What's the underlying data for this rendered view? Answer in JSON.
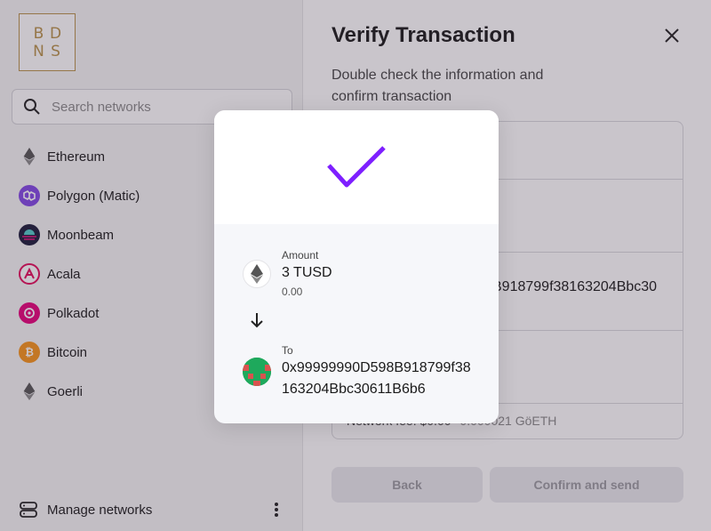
{
  "sidebar": {
    "logo_letters": [
      "B",
      "D",
      "N",
      "S"
    ],
    "search_placeholder": "Search networks",
    "networks": [
      {
        "label": "Ethereum",
        "color": "#ffffff"
      },
      {
        "label": "Polygon (Matic)",
        "color": "#8247e5"
      },
      {
        "label": "Moonbeam",
        "color": "#1b1b3a"
      },
      {
        "label": "Acala",
        "color": "#e40c5b"
      },
      {
        "label": "Polkadot",
        "color": "#e6007a"
      },
      {
        "label": "Bitcoin",
        "color": "#f7931a"
      },
      {
        "label": "Goerli",
        "color": "#ffffff"
      }
    ],
    "manage_label": "Manage networks"
  },
  "main": {
    "title": "Verify Transaction",
    "subtitle": "Double check the information and confirm transaction",
    "partial_address": "B918799f38163204Bbc30",
    "fee_label": "Network fee: $0.00",
    "fee_eth": "0.000021 GöETH",
    "back_label": "Back",
    "confirm_label": "Confirm and send"
  },
  "modal": {
    "amount_label": "Amount",
    "amount_value": "3 TUSD",
    "amount_fiat": "0.00",
    "to_label": "To",
    "to_address": "0x99999990D598B918799f38163204Bbc30611B6b6"
  },
  "colors": {
    "accent": "#7e1fff",
    "logo_gold": "#b8924a"
  }
}
